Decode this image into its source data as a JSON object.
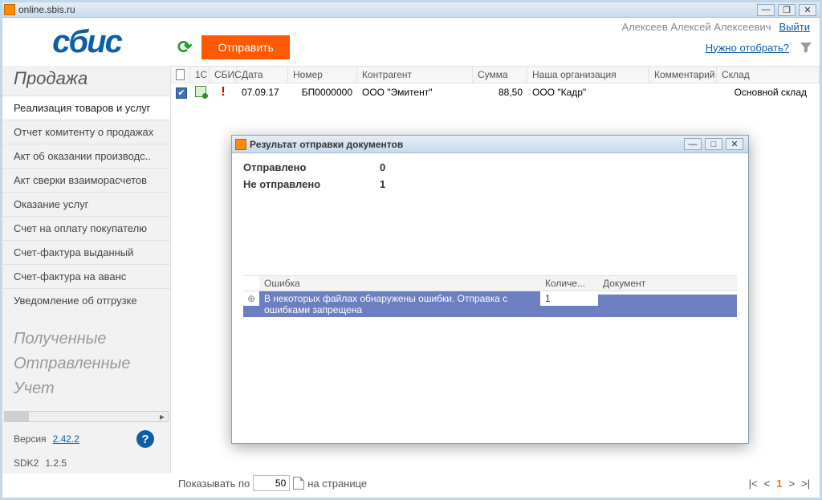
{
  "window_title": "online.sbis.ru",
  "user_name": "Алексеев Алексей Алексеевич",
  "logout_label": "Выйти",
  "logo": "сбис",
  "send_button": "Отправить",
  "need_filter": "Нужно отобрать?",
  "sidebar": {
    "title": "Продажа",
    "items": [
      "Реализация товаров и услуг",
      "Отчет комитенту о продажах",
      "Акт об оказании производс..",
      "Акт сверки взаиморасчетов",
      "Оказание услуг",
      "Счет на оплату покупателю",
      "Счет-фактура выданный",
      "Счет-фактура на аванс",
      "Уведомление об отгрузке"
    ],
    "sections": [
      "Полученные",
      "Отправленные",
      "Учет"
    ],
    "version_label": "Версия",
    "version": "2.42.2",
    "sdk_label": "SDK2",
    "sdk": "1.2.5"
  },
  "table": {
    "headers": {
      "c1c": "1С",
      "sbis": "СБИС",
      "date": "Дата",
      "num": "Номер",
      "contragent": "Контрагент",
      "sum": "Сумма",
      "org": "Наша организация",
      "comment": "Комментарий",
      "warehouse": "Склад"
    },
    "rows": [
      {
        "checked": true,
        "date": "07.09.17",
        "num": "БП0000000",
        "contragent": "ООО \"Эмитент\"",
        "sum": "88,50",
        "org": "ООО \"Кадр\"",
        "comment": "",
        "warehouse": "Основной склад"
      }
    ]
  },
  "dialog": {
    "title": "Результат отправки документов",
    "sent_label": "Отправлено",
    "sent_value": "0",
    "not_sent_label": "Не отправлено",
    "not_sent_value": "1",
    "columns": {
      "error": "Ошибка",
      "count": "Количе...",
      "doc": "Документ"
    },
    "rows": [
      {
        "error": "В некоторых файлах обнаружены ошибки. Отправка с ошибками запрещена",
        "count": "1",
        "doc": ""
      }
    ]
  },
  "footer": {
    "show_by": "Показывать по",
    "per_page": "50",
    "on_page": "на странице",
    "current": "1"
  }
}
